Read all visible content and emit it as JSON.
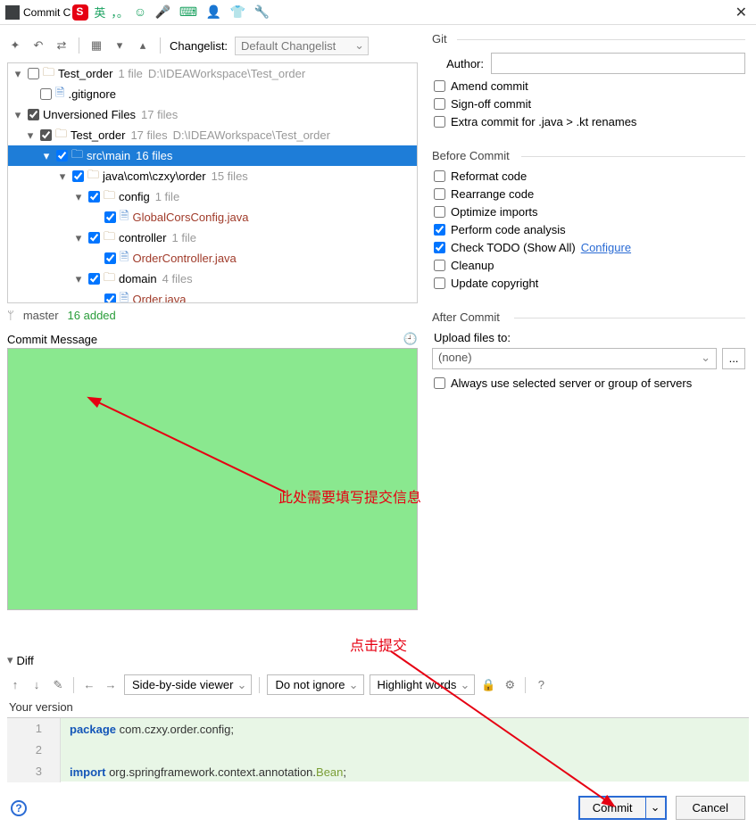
{
  "titlebar": {
    "title": "Commit C",
    "ime_lang": "英",
    "ime_punct": "，。",
    "close": "✕"
  },
  "toolbar": {
    "changelist_label": "Changelist:",
    "changelist_value": "Default Changelist"
  },
  "tree": {
    "r0": {
      "name": "Test_order",
      "count": "1 file",
      "path": "D:\\IDEAWorkspace\\Test_order"
    },
    "r1": {
      "name": ".gitignore"
    },
    "r2": {
      "name": "Unversioned Files",
      "count": "17 files"
    },
    "r3": {
      "name": "Test_order",
      "count": "17 files",
      "path": "D:\\IDEAWorkspace\\Test_order"
    },
    "r4": {
      "name": "src\\main",
      "count": "16 files"
    },
    "r5": {
      "name": "java\\com\\czxy\\order",
      "count": "15 files"
    },
    "r6": {
      "name": "config",
      "count": "1 file"
    },
    "r7": {
      "name": "GlobalCorsConfig.java"
    },
    "r8": {
      "name": "controller",
      "count": "1 file"
    },
    "r9": {
      "name": "OrderController.java"
    },
    "r10": {
      "name": "domain",
      "count": "4 files"
    },
    "r11": {
      "name": "Order.java"
    }
  },
  "branch": {
    "name": "master",
    "added": "16 added"
  },
  "commit_msg": {
    "label": "Commit Message"
  },
  "git": {
    "section": "Git",
    "author_label": "Author:",
    "amend": "Amend commit",
    "signoff": "Sign-off commit",
    "extra": "Extra commit for .java > .kt renames"
  },
  "before": {
    "section": "Before Commit",
    "reformat": "Reformat code",
    "rearrange": "Rearrange code",
    "optimize": "Optimize imports",
    "analysis": "Perform code analysis",
    "todo": "Check TODO (Show All)",
    "configure": "Configure",
    "cleanup": "Cleanup",
    "copyright": "Update copyright"
  },
  "after": {
    "section": "After Commit",
    "upload_label": "Upload files to:",
    "upload_value": "(none)",
    "more": "...",
    "always": "Always use selected server or group of servers"
  },
  "diff": {
    "label": "Diff",
    "viewer": "Side-by-side viewer",
    "ignore": "Do not ignore",
    "highlight": "Highlight words",
    "your_version": "Your version"
  },
  "code": {
    "l1n": "1",
    "l1_kw": "package",
    "l1_rest": " com.czxy.order.config;",
    "l2n": "2",
    "l3n": "3",
    "l3_kw": "import",
    "l3_mid": " org.springframework.context.annotation.",
    "l3_cls": "Bean",
    "l3_end": ";"
  },
  "buttons": {
    "commit": "Commit",
    "cancel": "Cancel",
    "help": "?"
  },
  "annotations": {
    "a1": "此处需要填写提交信息",
    "a2": "点击提交"
  }
}
